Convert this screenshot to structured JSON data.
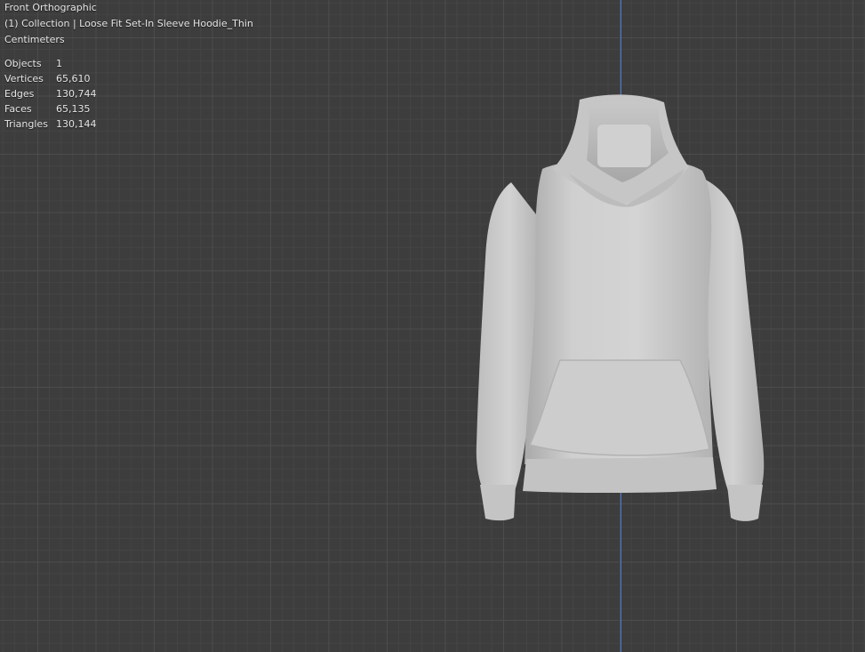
{
  "viewport": {
    "view_name": "Front Orthographic",
    "collection_label": "(1) Collection | Loose Fit Set-In Sleeve Hoodie_Thin",
    "units": "Centimeters",
    "stats": [
      {
        "label": "Objects",
        "value": "1"
      },
      {
        "label": "Vertices",
        "value": "65,610"
      },
      {
        "label": "Edges",
        "value": "130,744"
      },
      {
        "label": "Faces",
        "value": "65,135"
      },
      {
        "label": "Triangles",
        "value": "130,144"
      }
    ]
  },
  "colors": {
    "background": "#3d3d3d",
    "grid": "#4c4c4c",
    "axis_z": "#4f7fd6",
    "model": "#c9c9c9"
  }
}
